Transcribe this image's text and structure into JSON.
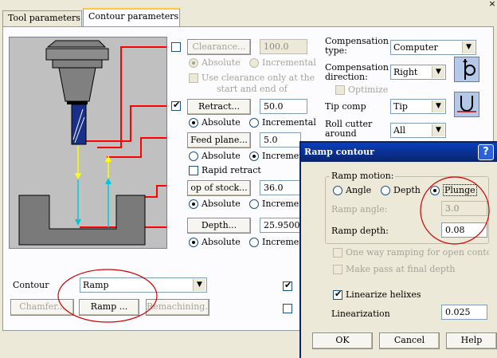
{
  "tabs": [
    "Tool parameters",
    "Contour parameters"
  ],
  "top_right_glyph": "×",
  "clearance": {
    "button": "Clearance...",
    "value": "100.0",
    "absolute": "Absolute",
    "incremental": "Incremental",
    "use_clearance": "Use clearance only at the",
    "use_clearance_2": "start and end of"
  },
  "retract": {
    "button": "Retract...",
    "value": "50.0",
    "absolute": "Absolute",
    "incremental": "Incremental"
  },
  "feed_plane": {
    "button": "Feed plane...",
    "value": "5.0",
    "absolute": "Absolute",
    "incremental": "Incremen",
    "rapid_retract": "Rapid retract"
  },
  "top_of_stock": {
    "button": "op of stock...",
    "value": "36.0",
    "absolute": "Absolute",
    "incremental": "Incremen"
  },
  "depth": {
    "button": "Depth...",
    "value": "25.95007",
    "absolute": "Absolute",
    "incremental": "Incremen"
  },
  "compensation": {
    "type_label": "Compensation type:",
    "type_value": "Computer",
    "direction_label": "Compensation direction:",
    "direction_value": "Right",
    "optimize": "Optimize",
    "tip_comp_label": "Tip comp",
    "tip_comp_value": "Tip",
    "roll_cutter_label": "Roll cutter around",
    "roll_cutter_value": "All"
  },
  "contour": {
    "label": "Contour",
    "value": "Ramp",
    "chamfer_button": "Chamfer...",
    "ramp_button": "Ramp ...",
    "remachining_button": "Remachining..."
  },
  "ramp_dialog": {
    "title": "Ramp contour",
    "help_glyph": "?",
    "group_label": "Ramp motion:",
    "angle": "Angle",
    "depth_opt": "Depth",
    "plunge": "Plunge",
    "ramp_angle_label": "Ramp angle:",
    "ramp_angle_value": "3.0",
    "ramp_depth_label": "Ramp depth:",
    "ramp_depth_value": "0.08",
    "one_way": "One way ramping for open conto",
    "make_pass": "Make pass at final depth",
    "linearize": "Linearize helixes",
    "linearization_label": "Linearization",
    "linearization_value": "0.025",
    "ok": "OK",
    "cancel": "Cancel",
    "help": "Help"
  },
  "colors": {
    "annotation": "#cc0000",
    "titlebar": "#0a246a",
    "preview_bg": "#c0c0c0",
    "tool_blue": "#1a2f8a"
  }
}
